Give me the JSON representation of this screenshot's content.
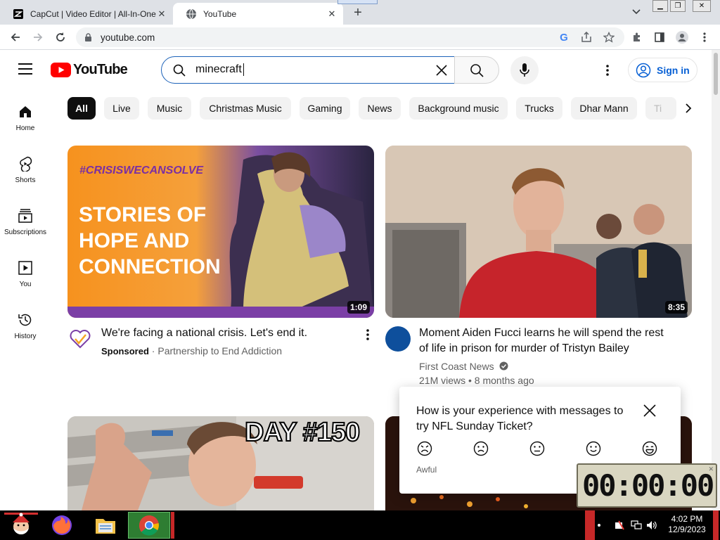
{
  "browser": {
    "tabs": [
      {
        "title": "CapCut | Video Editor | All-In-One",
        "active": false,
        "icon": "capcut-icon"
      },
      {
        "title": "YouTube",
        "active": true,
        "icon": "globe-icon"
      }
    ],
    "url": "youtube.com"
  },
  "header": {
    "logo_text": "YouTube",
    "search_value": "minecraft",
    "signin_label": "Sign in"
  },
  "sidebar": {
    "items": [
      {
        "label": "Home",
        "icon": "home-icon"
      },
      {
        "label": "Shorts",
        "icon": "shorts-icon"
      },
      {
        "label": "Subscriptions",
        "icon": "subscriptions-icon"
      },
      {
        "label": "You",
        "icon": "you-icon"
      },
      {
        "label": "History",
        "icon": "history-icon"
      }
    ]
  },
  "chips": [
    "All",
    "Live",
    "Music",
    "Christmas Music",
    "Gaming",
    "News",
    "Background music",
    "Trucks",
    "Dhar Mann",
    "Ti"
  ],
  "videos": [
    {
      "title": "We're facing a national crisis. Let's end it.",
      "sponsored": "Sponsored",
      "channel": "Partnership to End Addiction",
      "duration": "1:09",
      "thumb_hashtag": "#CRISISWECANSOLVE",
      "thumb_lines": [
        "STORIES OF",
        "HOPE AND",
        "CONNECTION"
      ]
    },
    {
      "title_line1": "Moment Aiden Fucci learns he will spend the rest",
      "title_line2": "of life in prison for murder of Tristyn Bailey",
      "channel": "First Coast News",
      "stats": "21M views • 8 months ago",
      "duration": "8:35"
    },
    {
      "thumb_text": "DAY #150"
    }
  ],
  "survey": {
    "question": "How is your experience with messages to try NFL Sunday Ticket?",
    "low_label": "Awful"
  },
  "timer": {
    "display": "00:00:00"
  },
  "taskbar": {
    "time": "4:02 PM",
    "date": "12/9/2023"
  },
  "colors": {
    "accent_blue": "#065fd4",
    "youtube_red": "#ff0000",
    "search_border": "#1c62b9"
  }
}
